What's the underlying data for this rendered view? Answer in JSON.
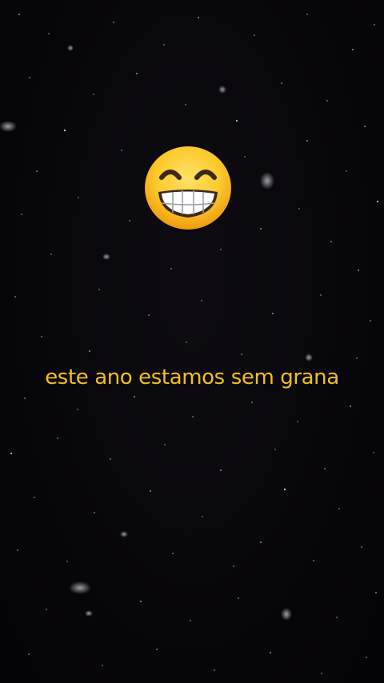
{
  "video": {
    "caption": "este ano estamos sem grana",
    "caption_color": "#f3bf1e",
    "background_color": "#07060a",
    "emoji_icon": "grinning-face-with-smiling-eyes"
  }
}
